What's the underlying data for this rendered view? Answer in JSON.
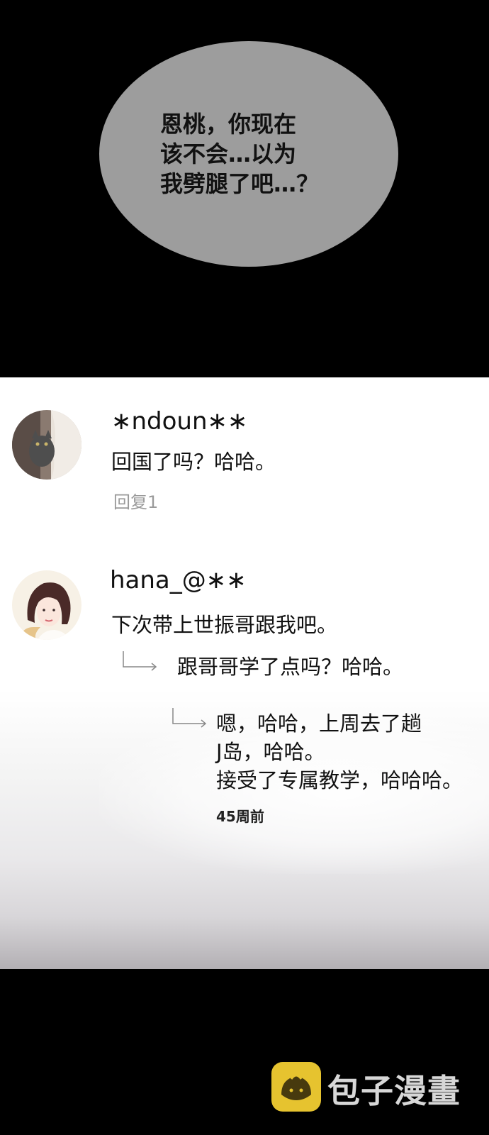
{
  "bubble": {
    "lines": [
      "恩桃，你现在",
      "该不会…以为",
      "我劈腿了吧…？"
    ]
  },
  "comments": [
    {
      "username": "∗ndoun∗∗",
      "text": "回国了吗？哈哈。",
      "reply_count": "回复1"
    },
    {
      "username": "hana_@∗∗",
      "text": "下次带上世振哥跟我吧。",
      "replies": [
        {
          "lines": [
            "跟哥哥学了点吗？哈哈。"
          ]
        },
        {
          "lines": [
            "嗯，哈哈，上周去了趟",
            "J岛，哈哈。",
            "接受了专属教学，哈哈哈。"
          ]
        }
      ],
      "time_ago": "45周前"
    }
  ],
  "watermark": {
    "logo_text": "包子漫畫",
    "logo_color": "#e6c32f"
  }
}
